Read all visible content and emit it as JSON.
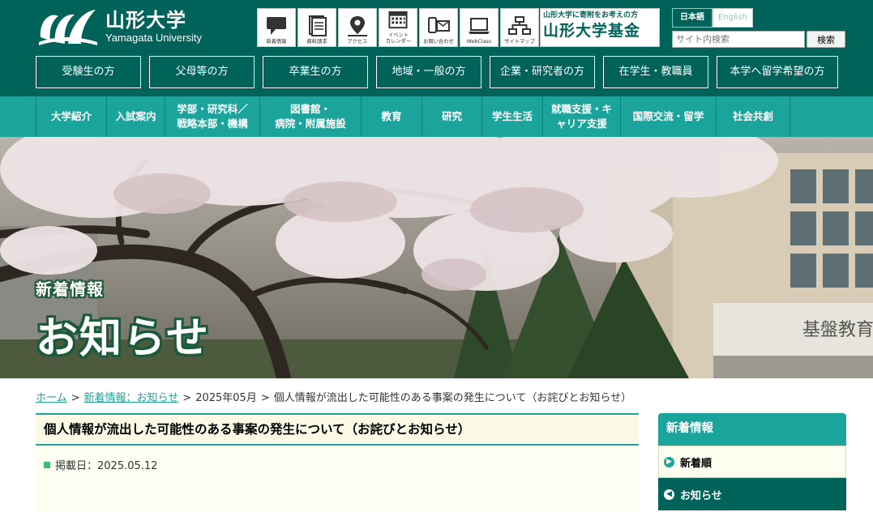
{
  "logo": {
    "name_ja": "山形大学",
    "name_en": "Yamagata University"
  },
  "utility_icons": [
    {
      "label": "新着情報",
      "icon": "chat-bubble-icon"
    },
    {
      "label": "資料請求",
      "icon": "documents-icon"
    },
    {
      "label": "アクセス",
      "icon": "map-pin-icon"
    },
    {
      "label": "イベント\nカレンダー",
      "icon": "calendar-icon"
    },
    {
      "label": "お問い合わせ",
      "icon": "contact-icon"
    },
    {
      "label": "WebClass",
      "icon": "laptop-icon"
    },
    {
      "label": "サイトマップ",
      "icon": "sitemap-icon"
    }
  ],
  "fund_banner": {
    "sub": "山形大学に寄附をお考えの方",
    "main": "山形大学基金"
  },
  "language": {
    "ja": "日本語",
    "en": "English"
  },
  "search": {
    "placeholder": "サイト内検索",
    "button": "検索"
  },
  "audience_nav": [
    "受験生の方",
    "父母等の方",
    "卒業生の方",
    "地域・一般の方",
    "企業・研究者の方",
    "在学生・教職員",
    "本学へ留学希望の方"
  ],
  "main_nav": [
    "大学紹介",
    "入試案内",
    "学部・研究科／\n戦略本部・機構",
    "図書館・\n病院・附属施設",
    "教育",
    "研究",
    "学生生活",
    "就職支援・キ\nャリア支援",
    "国際交流・留学",
    "社会共創"
  ],
  "hero": {
    "subtitle": "新着情報",
    "title": "お知らせ"
  },
  "breadcrumb": {
    "home": "ホーム",
    "news": "新着情報：お知らせ",
    "month": "2025年05月",
    "current": "個人情報が流出した可能性のある事案の発生について（お詫びとお知らせ）",
    "separator": ">"
  },
  "article": {
    "title": "個人情報が流出した可能性のある事案の発生について（お詫びとお知らせ）",
    "date_label": "掲載日：2025.05.12"
  },
  "sidebar": {
    "heading": "新着情報",
    "items": [
      {
        "label": "新着順",
        "active": false
      },
      {
        "label": "お知らせ",
        "active": true
      }
    ]
  },
  "colors": {
    "dark_green": "#00635a",
    "teal": "#1aa49b",
    "cream": "#fefef2"
  }
}
